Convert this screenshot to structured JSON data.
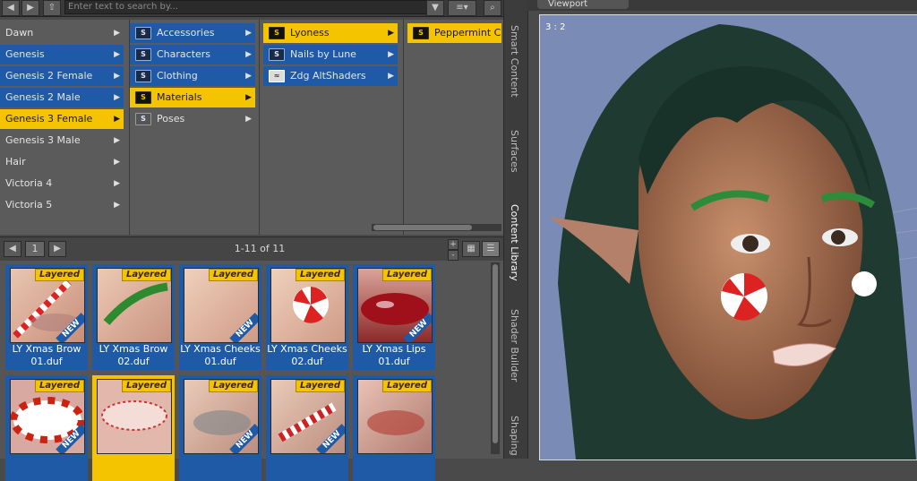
{
  "search": {
    "placeholder": "Enter text to search by..."
  },
  "columns": {
    "col1": [
      "Dawn",
      "Genesis",
      "Genesis 2 Female",
      "Genesis 2 Male",
      "Genesis 3 Female",
      "Genesis 3 Male",
      "Hair",
      "Victoria 4",
      "Victoria 5"
    ],
    "col2": [
      "Accessories",
      "Characters",
      "Clothing",
      "Materials",
      "Poses"
    ],
    "col3": [
      "Lyoness",
      "Nails by Lune",
      "Zdg AltShaders"
    ],
    "col4": [
      "Peppermint Che"
    ]
  },
  "nav": {
    "page": "1",
    "count": "1-11 of 11"
  },
  "tiles": [
    {
      "label1": "LY Xmas Brow",
      "label2": "01.duf",
      "badge": "Layered",
      "new": "NEW"
    },
    {
      "label1": "LY Xmas Brow",
      "label2": "02.duf",
      "badge": "Layered",
      "new": ""
    },
    {
      "label1": "LY Xmas Cheeks",
      "label2": "01.duf",
      "badge": "Layered",
      "new": "NEW"
    },
    {
      "label1": "LY Xmas Cheeks",
      "label2": "02.duf",
      "badge": "Layered",
      "new": ""
    },
    {
      "label1": "LY Xmas Lips",
      "label2": "01.duf",
      "badge": "Layered",
      "new": "NEW"
    },
    {
      "label1": "",
      "label2": "",
      "badge": "Layered",
      "new": "NEW"
    },
    {
      "label1": "",
      "label2": "",
      "badge": "Layered",
      "new": ""
    },
    {
      "label1": "",
      "label2": "",
      "badge": "Layered",
      "new": "NEW"
    },
    {
      "label1": "",
      "label2": "",
      "badge": "Layered",
      "new": "NEW"
    },
    {
      "label1": "",
      "label2": "",
      "badge": "Layered",
      "new": ""
    }
  ],
  "side_tabs": [
    "Smart Content",
    "Surfaces",
    "Content Library",
    "Shader Builder",
    "Shaping"
  ],
  "viewport": {
    "tab": "Viewport",
    "ratio": "3 : 2"
  },
  "colors": {
    "blue": "#1f5aa6",
    "yellow": "#f5c400"
  }
}
